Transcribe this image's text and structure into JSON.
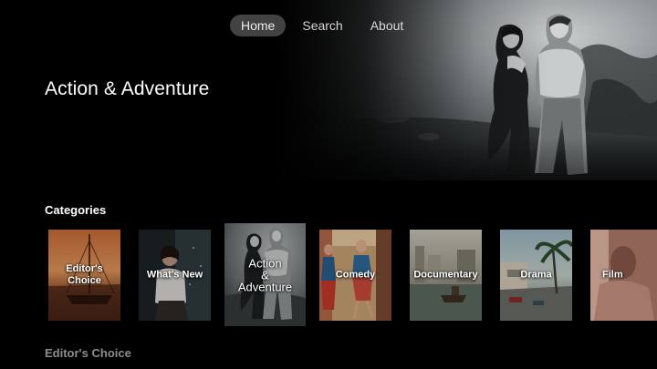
{
  "nav": {
    "tabs": [
      {
        "label": "Home",
        "active": true
      },
      {
        "label": "Search",
        "active": false
      },
      {
        "label": "About",
        "active": false
      }
    ]
  },
  "hero": {
    "title": "Action & Adventure",
    "image": "black-and-white film still of a couple"
  },
  "categories": {
    "heading": "Categories",
    "focused_index": 2,
    "tiles": [
      {
        "label": "Editor's Choice",
        "lines": [
          "Editor's",
          "Choice"
        ],
        "image": "sailboat at sunset"
      },
      {
        "label": "What's New",
        "lines": [
          "What's New"
        ],
        "image": "woman in night scene"
      },
      {
        "label": "Action & Adventure",
        "lines": [
          "Action",
          "&",
          "Adventure"
        ],
        "image": "black-and-white film still"
      },
      {
        "label": "Comedy",
        "lines": [
          "Comedy"
        ],
        "image": "dancers on stage"
      },
      {
        "label": "Documentary",
        "lines": [
          "Documentary"
        ],
        "image": "boat on a canal"
      },
      {
        "label": "Drama",
        "lines": [
          "Drama"
        ],
        "image": "palm-lined street"
      },
      {
        "label": "Film Noir",
        "lines": [
          "Film"
        ],
        "image": "portrait"
      }
    ]
  },
  "next_section": {
    "heading": "Editor's Choice"
  }
}
